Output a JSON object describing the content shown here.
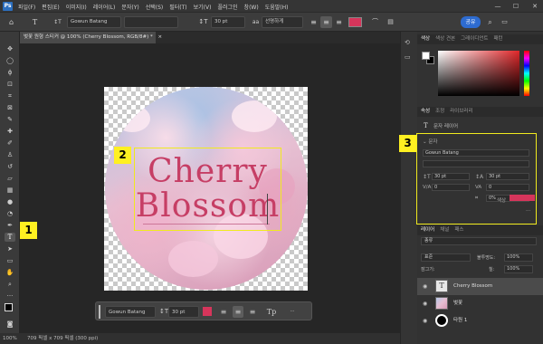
{
  "app": {
    "icon_label": "Ps"
  },
  "menu": [
    "파일(F)",
    "편집(E)",
    "이미지(I)",
    "레이어(L)",
    "문자(Y)",
    "선택(S)",
    "필터(T)",
    "보기(V)",
    "플러그인",
    "창(W)",
    "도움말(H)"
  ],
  "options": {
    "font_family": "Gowun Batang",
    "font_size": "30 pt",
    "antialias": "선명하게",
    "text_color": "#d6355b",
    "share_label": "공유"
  },
  "document": {
    "tab_title": "벚꽃 원형 스티커 @ 100% (Cherry Blossom, RGB/8#) *",
    "close_glyph": "×",
    "line1": "Cherry",
    "line2": "Blossom"
  },
  "context_bar": {
    "font_family": "Gowun Batang",
    "font_size": "30 pt",
    "color": "#d6355b",
    "more": "···"
  },
  "status": {
    "zoom": "100%",
    "doc_size": "709 픽셀 x 709 픽셀 (300 ppi)"
  },
  "markers": [
    "1",
    "2",
    "3"
  ],
  "color_panel": {
    "tabs": [
      "색상",
      "색상 견본",
      "그레이디언트",
      "패턴"
    ]
  },
  "props_panel": {
    "tabs": [
      "속성",
      "조정",
      "라이브러리"
    ],
    "layer_kind": "문자 레이어",
    "section": "문자",
    "font_family": "Gowun Batang",
    "font_size": "30 pt",
    "leading": "30 pt",
    "kerning": "0",
    "tracking": "0",
    "scale": "0%",
    "color_label": "색상",
    "more": "···"
  },
  "layers_panel": {
    "tabs": [
      "레이어",
      "채널",
      "패스"
    ],
    "kind_filter": "종류",
    "blend_mode": "표준",
    "opacity_label": "불투명도:",
    "opacity": "100%",
    "lock_label": "잠그기:",
    "fill_label": "칠:",
    "fill": "100%",
    "layers": [
      {
        "name": "Cherry Blossom",
        "type": "text"
      },
      {
        "name": "벚꽃",
        "type": "image"
      },
      {
        "name": "타원 1",
        "type": "shape"
      }
    ]
  },
  "colors": {
    "accent": "#2d6bd0",
    "marker": "#fff021",
    "text": "#c63e65"
  }
}
